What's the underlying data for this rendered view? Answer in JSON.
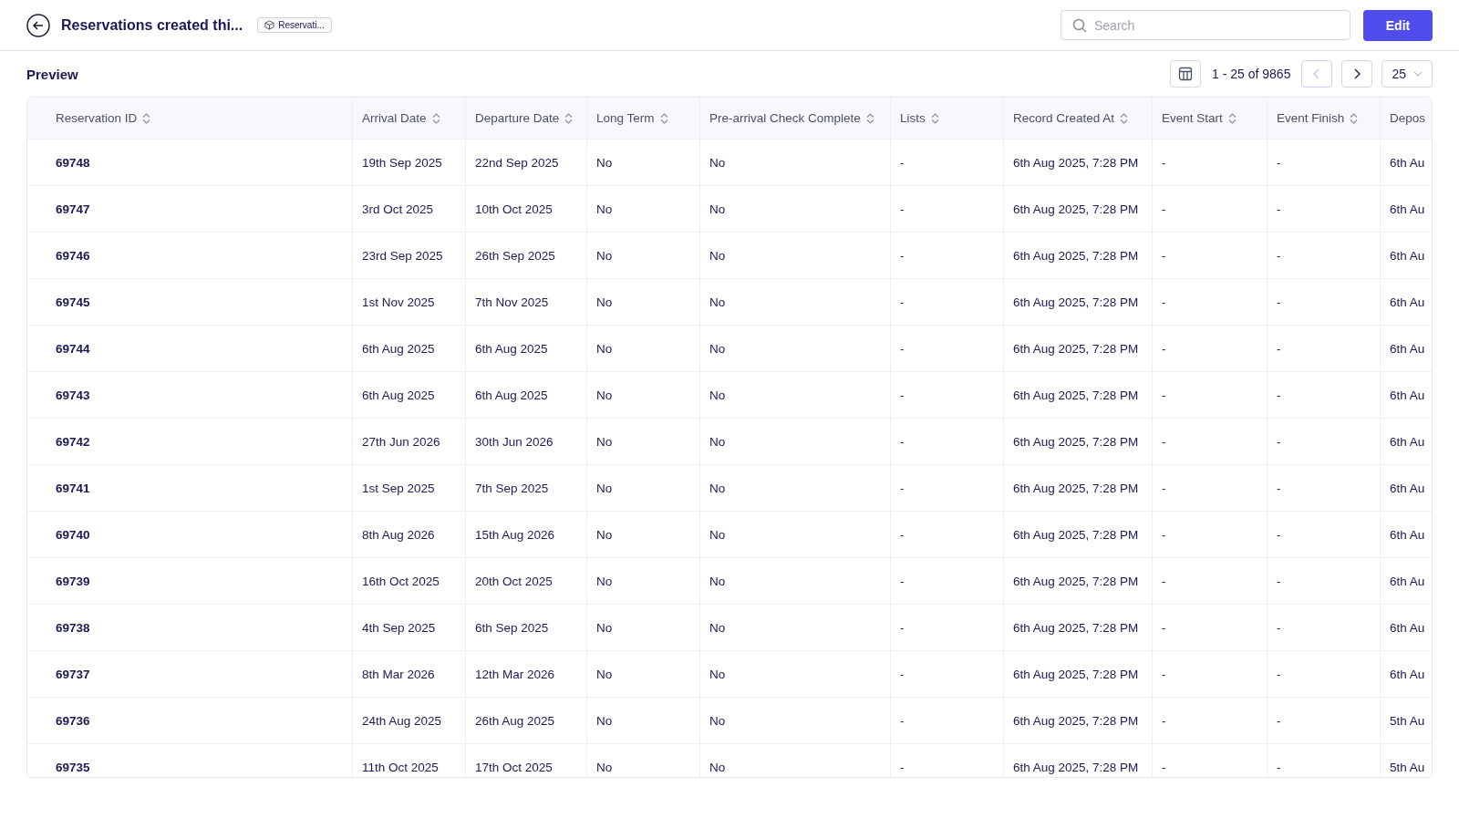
{
  "header": {
    "title": "Reservations created thi...",
    "tag": "Reservati...",
    "search": {
      "placeholder": "Search"
    },
    "edit_button": "Edit"
  },
  "preview": {
    "title": "Preview",
    "range": "1 - 25 of 9865",
    "prev_disabled": true,
    "page_size": "25"
  },
  "table": {
    "columns": [
      "Reservation ID",
      "Arrival Date",
      "Departure Date",
      "Long Term",
      "Pre-arrival Check Complete",
      "Lists",
      "Record Created At",
      "Event Start",
      "Event Finish",
      "Depos"
    ],
    "rows": [
      [
        "69748",
        "19th Sep 2025",
        "22nd Sep 2025",
        "No",
        "No",
        "-",
        "6th Aug 2025, 7:28 PM",
        "-",
        "-",
        "6th Au"
      ],
      [
        "69747",
        "3rd Oct 2025",
        "10th Oct 2025",
        "No",
        "No",
        "-",
        "6th Aug 2025, 7:28 PM",
        "-",
        "-",
        "6th Au"
      ],
      [
        "69746",
        "23rd Sep 2025",
        "26th Sep 2025",
        "No",
        "No",
        "-",
        "6th Aug 2025, 7:28 PM",
        "-",
        "-",
        "6th Au"
      ],
      [
        "69745",
        "1st Nov 2025",
        "7th Nov 2025",
        "No",
        "No",
        "-",
        "6th Aug 2025, 7:28 PM",
        "-",
        "-",
        "6th Au"
      ],
      [
        "69744",
        "6th Aug 2025",
        "6th Aug 2025",
        "No",
        "No",
        "-",
        "6th Aug 2025, 7:28 PM",
        "-",
        "-",
        "6th Au"
      ],
      [
        "69743",
        "6th Aug 2025",
        "6th Aug 2025",
        "No",
        "No",
        "-",
        "6th Aug 2025, 7:28 PM",
        "-",
        "-",
        "6th Au"
      ],
      [
        "69742",
        "27th Jun 2026",
        "30th Jun 2026",
        "No",
        "No",
        "-",
        "6th Aug 2025, 7:28 PM",
        "-",
        "-",
        "6th Au"
      ],
      [
        "69741",
        "1st Sep 2025",
        "7th Sep 2025",
        "No",
        "No",
        "-",
        "6th Aug 2025, 7:28 PM",
        "-",
        "-",
        "6th Au"
      ],
      [
        "69740",
        "8th Aug 2026",
        "15th Aug 2026",
        "No",
        "No",
        "-",
        "6th Aug 2025, 7:28 PM",
        "-",
        "-",
        "6th Au"
      ],
      [
        "69739",
        "16th Oct 2025",
        "20th Oct 2025",
        "No",
        "No",
        "-",
        "6th Aug 2025, 7:28 PM",
        "-",
        "-",
        "6th Au"
      ],
      [
        "69738",
        "4th Sep 2025",
        "6th Sep 2025",
        "No",
        "No",
        "-",
        "6th Aug 2025, 7:28 PM",
        "-",
        "-",
        "6th Au"
      ],
      [
        "69737",
        "8th Mar 2026",
        "12th Mar 2026",
        "No",
        "No",
        "-",
        "6th Aug 2025, 7:28 PM",
        "-",
        "-",
        "6th Au"
      ],
      [
        "69736",
        "24th Aug 2025",
        "26th Aug 2025",
        "No",
        "No",
        "-",
        "6th Aug 2025, 7:28 PM",
        "-",
        "-",
        "5th Au"
      ],
      [
        "69735",
        "11th Oct 2025",
        "17th Oct 2025",
        "No",
        "No",
        "-",
        "6th Aug 2025, 7:28 PM",
        "-",
        "-",
        "5th Au"
      ]
    ]
  }
}
